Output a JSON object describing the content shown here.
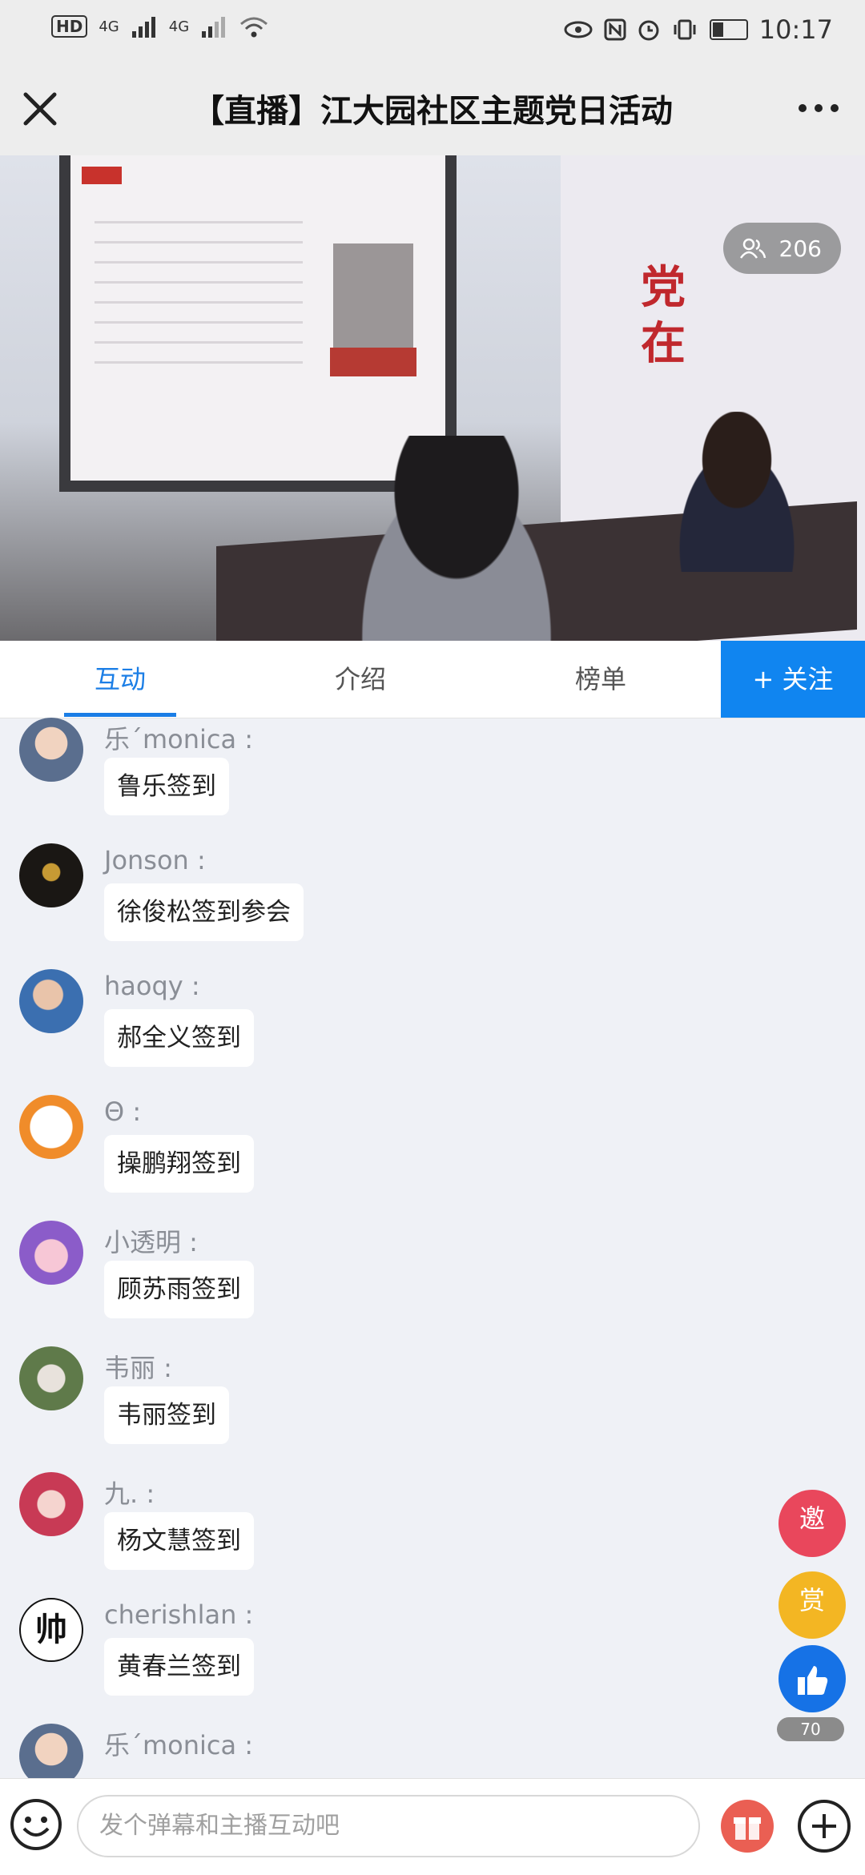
{
  "status_bar": {
    "hd": "HD",
    "net1": "4G",
    "net2": "4G",
    "time": "10:17",
    "battery_level": 0.35
  },
  "header": {
    "title": "【直播】江大园社区主题党日活动",
    "close_icon": "close-icon",
    "more_icon": "more-dots-icon"
  },
  "video": {
    "viewer_count": "206",
    "viewer_icon": "people-icon"
  },
  "tabs": [
    {
      "label": "互动",
      "active": true
    },
    {
      "label": "介绍",
      "active": false
    },
    {
      "label": "榜单",
      "active": false
    }
  ],
  "follow_label": "+ 关注",
  "accent_color": "#1085f0",
  "messages": [
    {
      "user": "乐´monica :",
      "text": "鲁乐签到"
    },
    {
      "user": "Jonson :",
      "text": "徐俊松签到参会"
    },
    {
      "user": "haoqy :",
      "text": "郝全义签到"
    },
    {
      "user": "Θ :",
      "text": "操鹏翔签到"
    },
    {
      "user": "小透明 :",
      "text": "顾苏雨签到"
    },
    {
      "user": "韦丽 :",
      "text": "韦丽签到"
    },
    {
      "user": "九. :",
      "text": "杨文慧签到"
    },
    {
      "user": "cherishlan :",
      "text": "黄春兰签到"
    },
    {
      "user": "乐´monica :",
      "text": ""
    }
  ],
  "float_actions": {
    "invite": "邀",
    "reward": "赏",
    "like_count": "70"
  },
  "composer": {
    "placeholder": "发个弹幕和主播互动吧"
  },
  "avatar_text": "帅"
}
